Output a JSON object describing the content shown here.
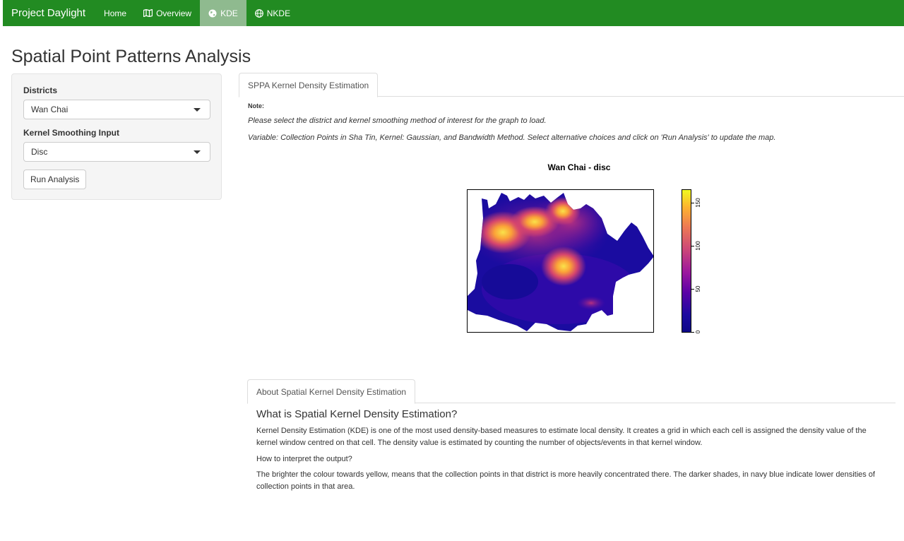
{
  "navbar": {
    "brand": "Project Daylight",
    "items": [
      {
        "label": "Home",
        "icon": "",
        "active": false
      },
      {
        "label": "Overview",
        "icon": "map-icon",
        "active": false
      },
      {
        "label": "KDE",
        "icon": "globe-icon",
        "active": true
      },
      {
        "label": "NKDE",
        "icon": "globe-icon",
        "active": false
      }
    ],
    "bg_color": "#228b22",
    "active_color": "#8fba8f"
  },
  "page_title": "Spatial Point Patterns Analysis",
  "sidebar": {
    "districts_label": "Districts",
    "districts_value": "Wan Chai",
    "kernel_label": "Kernel Smoothing Input",
    "kernel_value": "Disc",
    "run_button": "Run Analysis"
  },
  "main_tab": {
    "label": "SPPA Kernel Density Estimation",
    "note_label": "Note:",
    "note_line1": "Please select the district and kernel smoothing method of interest for the graph to load.",
    "note_line2": "Variable: Collection Points in Sha Tin, Kernel: Gaussian, and Bandwidth Method. Select alternative choices and click on 'Run Analysis' to update the map."
  },
  "plot": {
    "title": "Wan Chai - disc",
    "colorbar_ticks": [
      "0",
      "50",
      "100",
      "150"
    ],
    "colors": {
      "low": "#0d0887",
      "mid": "#cc4778",
      "high": "#f0f921"
    }
  },
  "about": {
    "tab_label": "About Spatial Kernel Density Estimation",
    "heading": "What is Spatial Kernel Density Estimation?",
    "p1": "Kernel Density Estimation (KDE) is one of the most used density-based measures to estimate local density. It creates a grid in which each cell is assigned the density value of the kernel window centred on that cell. The density value is estimated by counting the number of objects/events in that kernel window.",
    "p2": "How to interpret the output?",
    "p3": "The brighter the colour towards yellow, means that the collection points in that district is more heavily concentrated there. The darker shades, in navy blue indicate lower densities of collection points in that area."
  }
}
